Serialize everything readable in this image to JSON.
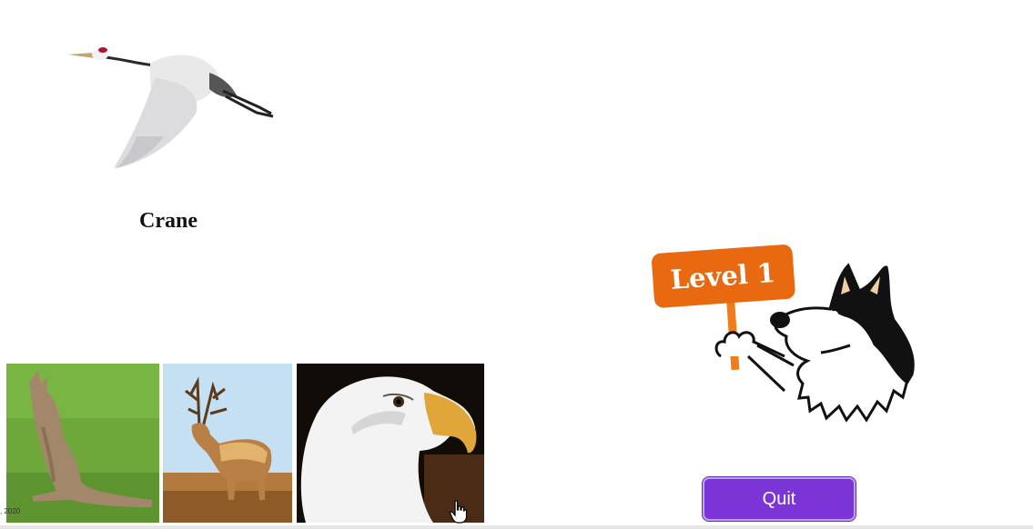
{
  "game": {
    "animal_name": "Crane",
    "target_image_icon": "crane-illustration",
    "choices": [
      {
        "label": "kangaroo",
        "icon": "kangaroo-photo"
      },
      {
        "label": "elk",
        "icon": "elk-photo"
      },
      {
        "label": "eagle",
        "icon": "eagle-photo"
      }
    ],
    "year_text": ", 2020"
  },
  "mascot": {
    "sign_text": "Level 1",
    "icon": "husky-holding-sign",
    "sign_color": "#e8690f",
    "post_color": "#f07d1a"
  },
  "controls": {
    "quit_label": "Quit",
    "quit_color": "#7b35d6"
  }
}
